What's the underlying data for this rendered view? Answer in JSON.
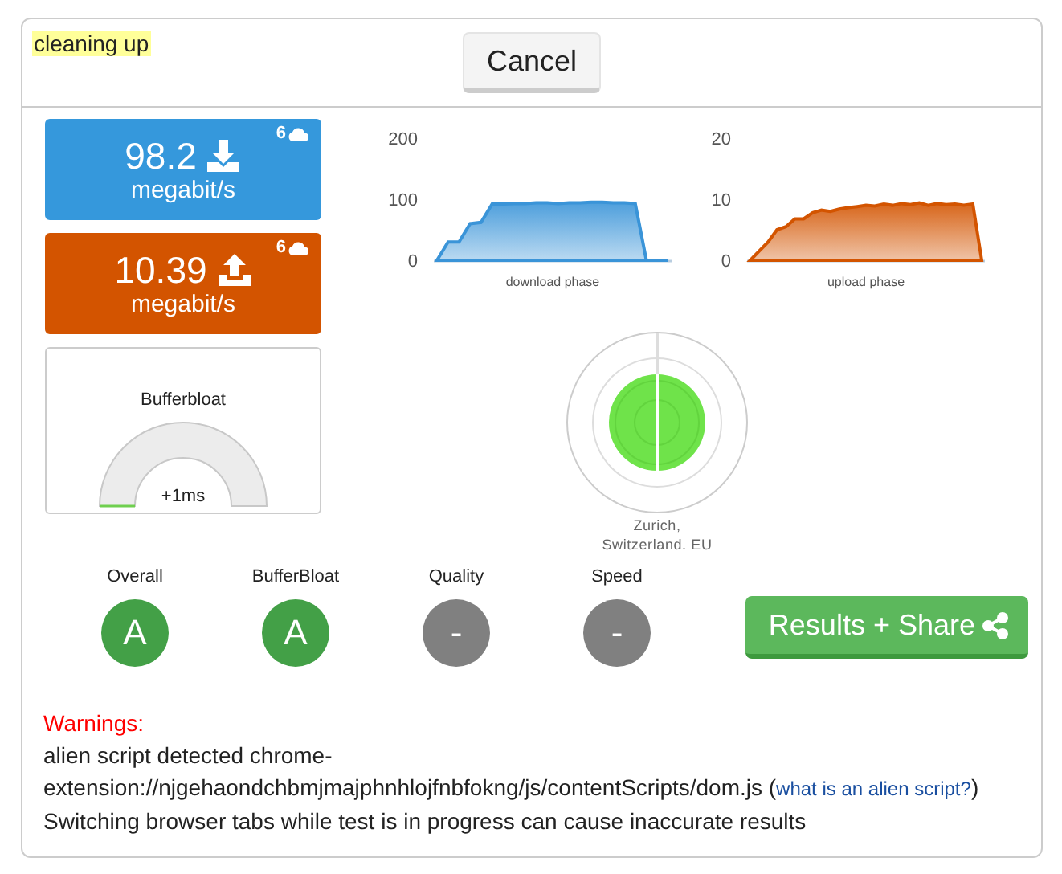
{
  "status": "cleaning up",
  "cancel_button": "Cancel",
  "download": {
    "value": "98.2",
    "unit": "megabit/s",
    "streams": "6"
  },
  "upload": {
    "value": "10.39",
    "unit": "megabit/s",
    "streams": "6"
  },
  "bufferbloat": {
    "title": "Bufferbloat",
    "reading": "+1ms"
  },
  "charts": [
    {
      "chart_data": {
        "type": "area",
        "xlabel": "download phase",
        "yticks": [
          0,
          100,
          200
        ],
        "ylim": [
          0,
          200
        ],
        "series": [
          {
            "color": "#3a94d8",
            "values": [
              0,
              30,
              30,
              60,
              62,
              92,
              92,
              93,
              93,
              94,
              94,
              93,
              94,
              94,
              95,
              95,
              94,
              94,
              93,
              0,
              0,
              0
            ]
          }
        ]
      }
    },
    {
      "chart_data": {
        "type": "area",
        "xlabel": "upload phase",
        "yticks": [
          0,
          10,
          20
        ],
        "ylim": [
          0,
          20
        ],
        "series": [
          {
            "color": "#d35400",
            "values": [
              0,
              1.5,
              3,
              5,
              5.5,
              6.8,
              6.8,
              7.8,
              8.2,
              8,
              8.4,
              8.6,
              8.8,
              9,
              8.9,
              9.2,
              9,
              9.3,
              9.1,
              9.4,
              9,
              9.3,
              9.1,
              9.2,
              9,
              9.2,
              0
            ]
          }
        ]
      }
    }
  ],
  "location": [
    "Zurich,",
    "Switzerland. EU"
  ],
  "grades": [
    {
      "label": "Overall",
      "grade": "A",
      "color": "#43a047"
    },
    {
      "label": "BufferBloat",
      "grade": "A",
      "color": "#43a047"
    },
    {
      "label": "Quality",
      "grade": "-",
      "color": "#808080"
    },
    {
      "label": "Speed",
      "grade": "-",
      "color": "#808080"
    }
  ],
  "results_button": "Results + Share",
  "warnings": {
    "title": "Warnings:",
    "alien_script": "alien script detected chrome-extension://njgehaondchbmjmajphnhlojfnbfokng/js/contentScripts/dom.js (",
    "alien_link": "what is an alien script?",
    "alien_close": ")",
    "tab_warning": "Switching browser tabs while test is in progress can cause inaccurate results"
  }
}
